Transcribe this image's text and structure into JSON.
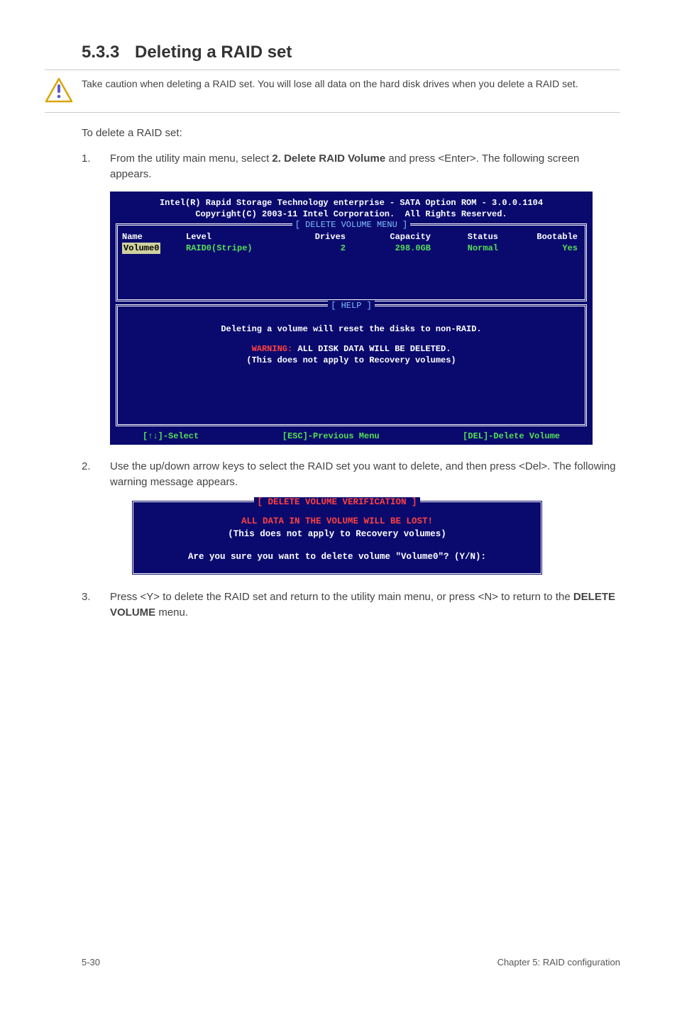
{
  "section": {
    "number": "5.3.3",
    "title": "Deleting a RAID set"
  },
  "caution": "Take caution when deleting a RAID set. You will lose all data on the hard disk drives when you delete a RAID set.",
  "intro": "To delete a RAID set:",
  "step1": {
    "num": "1.",
    "prefix": "From the utility main menu, select ",
    "bold": "2. Delete RAID Volume",
    "suffix": " and press <Enter>. The following screen appears."
  },
  "bios": {
    "header1": "Intel(R) Rapid Storage Technology enterprise - SATA Option ROM - 3.0.0.1104",
    "header2": "Copyright(C) 2003-11 Intel Corporation.  All Rights Reserved.",
    "deleteMenuTitle": "[ DELETE VOLUME MENU ]",
    "cols": {
      "name": "Name",
      "level": "Level",
      "drives": "Drives",
      "capacity": "Capacity",
      "status": "Status",
      "bootable": "Bootable"
    },
    "row": {
      "name": "Volume0",
      "level": "RAID0(Stripe)",
      "drives": "2",
      "capacity": "298.0GB",
      "status": "Normal",
      "bootable": "Yes"
    },
    "helpTitle": "[ HELP ]",
    "help1": "Deleting a volume will reset the disks to non-RAID.",
    "help2a": "WARNING:",
    "help2b": " ALL DISK DATA WILL BE DELETED.",
    "help3": "(This does not apply to Recovery volumes)",
    "footer": {
      "select": "[↑↓]-Select",
      "prev": "[ESC]-Previous Menu",
      "del": "[DEL]-Delete Volume"
    }
  },
  "step2": {
    "num": "2.",
    "text": "Use the up/down arrow keys to select the RAID set you want to delete, and then press <Del>. The following warning message appears."
  },
  "dialog": {
    "title": "[ DELETE VOLUME VERIFICATION ]",
    "line1": "ALL DATA IN THE VOLUME WILL BE LOST!",
    "line2": "(This does not apply to Recovery volumes)",
    "line3": "Are you sure you want to delete volume \"Volume0\"? (Y/N):"
  },
  "step3": {
    "num": "3.",
    "pre": "Press <Y> to delete the RAID set and return to the utility main menu, or press <N> to return to the ",
    "bold": "DELETE VOLUME",
    "post": " menu."
  },
  "footer": {
    "left": "5-30",
    "right": "Chapter 5: RAID configuration"
  }
}
